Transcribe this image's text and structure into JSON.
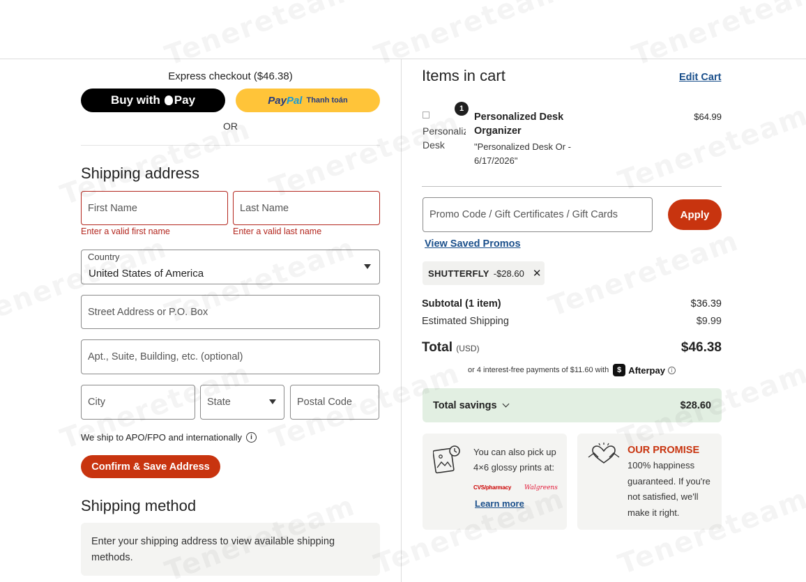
{
  "express": {
    "title": "Express checkout ($46.38)",
    "apple_pay_label": "Buy with",
    "apple_pay_suffix": "Pay",
    "paypal_logo_a": "Pay",
    "paypal_logo_b": "Pal",
    "paypal_text": "Thanh toán",
    "or_label": "OR"
  },
  "shipping_address": {
    "heading": "Shipping address",
    "first_name_placeholder": "First Name",
    "first_name_error": "Enter a valid first name",
    "last_name_placeholder": "Last Name",
    "last_name_error": "Enter a valid last name",
    "country_label": "Country",
    "country_value": "United States of America",
    "street_placeholder": "Street Address or P.O. Box",
    "apt_placeholder": "Apt., Suite, Building, etc. (optional)",
    "city_placeholder": "City",
    "state_placeholder": "State",
    "postal_placeholder": "Postal Code",
    "ship_note": "We ship to APO/FPO and internationally",
    "confirm_label": "Confirm & Save Address"
  },
  "shipping_method": {
    "heading": "Shipping method",
    "message": "Enter your shipping address to view available shipping methods."
  },
  "cart": {
    "title": "Items in cart",
    "edit_label": "Edit Cart",
    "item": {
      "image_alt": "Personalized Desk Organizer",
      "quantity": "1",
      "name": "Personalized Desk Organizer",
      "description": "\"Personalized Desk Or - 6/17/2026\"",
      "price": "$64.99"
    },
    "promo_placeholder": "Promo Code / Gift Certificates / Gift Cards",
    "apply_label": "Apply",
    "saved_promos_label": "View Saved Promos",
    "applied_promo_code": "SHUTTERFLY",
    "applied_promo_amount": "-$28.60",
    "subtotal_label": "Subtotal (1 item)",
    "subtotal_value": "$36.39",
    "shipping_label": "Estimated Shipping",
    "shipping_value": "$9.99",
    "total_label": "Total",
    "total_currency": "(USD)",
    "total_value": "$46.38",
    "afterpay_text": "or 4 interest-free payments of $11.60 with",
    "afterpay_name": "Afterpay",
    "savings_label": "Total savings",
    "savings_value": "$28.60"
  },
  "pickup_card": {
    "text": "You can also pick up 4×6 glossy prints at:",
    "cvs_label": "CVS/pharmacy",
    "walgreens_label": "Walgreens",
    "learn_more": "Learn more"
  },
  "promise_card": {
    "title": "OUR PROMISE",
    "text": "100% happiness guaranteed. If you're not satisfied, we'll make it right."
  },
  "watermark": "Tenereteam",
  "colors": {
    "accent": "#c8340f",
    "link": "#1a4f8b",
    "error": "#b3261e",
    "paypal_yellow": "#ffc439",
    "savings_bg": "#e2efe2"
  }
}
